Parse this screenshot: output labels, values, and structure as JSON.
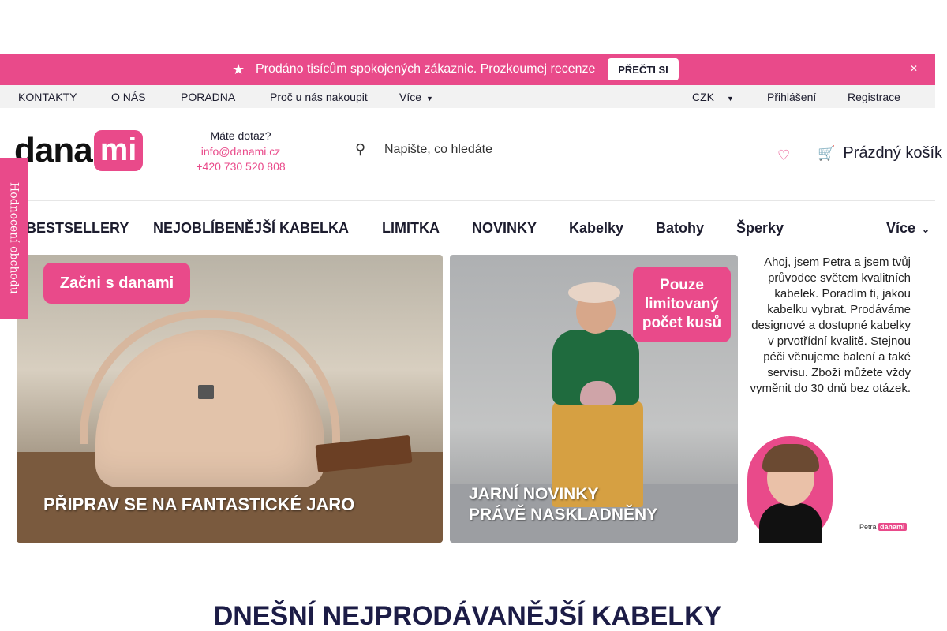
{
  "promo": {
    "text": "Prodáno tisícům spokojených zákaznic. Prozkoumej recenze",
    "button": "PŘEČTI SI",
    "icon": "star-icon",
    "close_icon": "close-icon",
    "background": "#e94a8a"
  },
  "topbar": {
    "links": [
      "KONTAKTY",
      "O NÁS",
      "PORADNA",
      "Proč u nás nakoupit",
      "Více"
    ],
    "currency": "CZK",
    "login": "Přihlášení",
    "register": "Registrace"
  },
  "header": {
    "logo_part1": "dana",
    "logo_part2": "mi",
    "contact_title": "Máte dotaz?",
    "email": "info@danami.cz",
    "phone": "+420 730 520 808",
    "search_placeholder": "Napište, co hledáte",
    "cart_label": "Prázdný košík",
    "accent": "#e94a8a"
  },
  "nav": {
    "items": [
      "BESTSELLERY",
      "NEJOBLÍBENĚJŠÍ KABELKA",
      "LIMITKA",
      "NOVINKY",
      "Kabelky",
      "Batohy",
      "Šperky"
    ],
    "more": "Více",
    "active": "LIMITKA"
  },
  "review_tab": "Hodnocení obchodu",
  "banners": {
    "b1_label": "Začni s danami",
    "b1_caption": "PŘIPRAV SE NA FANTASTICKÉ JARO",
    "b2_label": "Pouze limitovaný počet kusů",
    "b2_caption_line1": "JARNÍ NOVINKY",
    "b2_caption_line2": "PRÁVĚ NASKLADNĚNY",
    "b3_text": "Ahoj, jsem Petra a jsem tvůj průvodce světem kvalitních kabelek. Poradím ti, jakou kabelku vybrat. Prodáváme designové a dostupné kabelky v prvotřídní kvalitě. Stejnou péči věnujeme balení a také servisu. Zboží můžete vždy vyměnit do 30 dnů bez otázek.",
    "b3_sign": "Petra",
    "b3_brand": "danami"
  },
  "section_title": "DNEŠNÍ NEJPRODÁVANĚJŠÍ KABELKY"
}
